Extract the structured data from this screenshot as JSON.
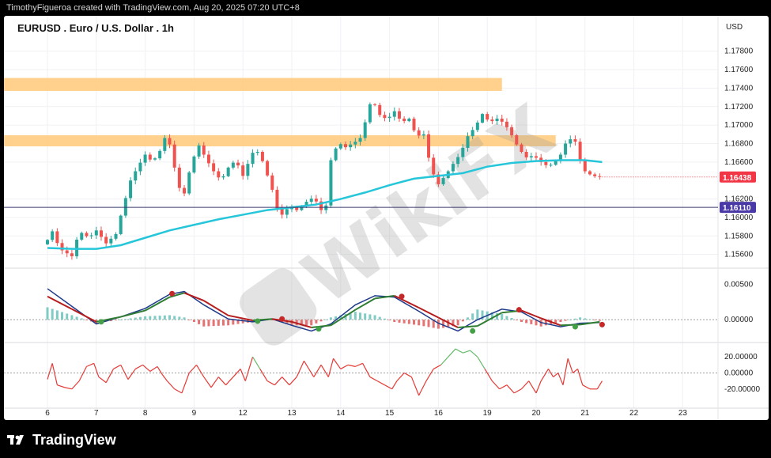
{
  "header": {
    "attribution": "TimothyFigueroa created with TradingView.com, Aug 20, 2025 07:20 UTC+8"
  },
  "footer": {
    "brand": "TradingView"
  },
  "watermark": {
    "text": "WikiFX"
  },
  "colors": {
    "up": "#26a69a",
    "down": "#ef5350",
    "zone": "#ffcc80",
    "ma": "#26c6da",
    "macd_fast": "#1e3a8a",
    "macd_slow": "#2e7d32",
    "price_badge": "#f23645",
    "level_badge": "#4a3aa8",
    "osc": "#e53935",
    "osc_high": "#66bb6a"
  },
  "chart_data": {
    "type": "candlestick",
    "title": "EURUSD . Euro / U.S. Dollar . 1h",
    "currency": "USD",
    "y_ticks": [
      "1.17800",
      "1.17600",
      "1.17400",
      "1.17200",
      "1.17000",
      "1.16800",
      "1.16600",
      "1.16200",
      "1.16000",
      "1.15800",
      "1.15600"
    ],
    "ylim": [
      1.1546,
      1.1796
    ],
    "x_ticks": [
      "6",
      "7",
      "8",
      "9",
      "12",
      "13",
      "14",
      "15",
      "16",
      "19",
      "20",
      "21",
      "22",
      "23"
    ],
    "last_price": {
      "label": "1.16438",
      "value": 1.16438
    },
    "horizontal_level": {
      "label": "1.16110",
      "value": 1.1611
    },
    "resistance_zones": [
      {
        "low": 1.1737,
        "high": 1.1751,
        "x_start": 0,
        "x_end": 9.3
      },
      {
        "low": 1.1677,
        "high": 1.1689,
        "x_start": 0,
        "x_end": 10.4
      }
    ],
    "price_path": [
      [
        0.0,
        1.1571
      ],
      [
        0.15,
        1.1585
      ],
      [
        0.3,
        1.1566
      ],
      [
        0.55,
        1.1558
      ],
      [
        0.7,
        1.1585
      ],
      [
        0.9,
        1.1578
      ],
      [
        1.05,
        1.1586
      ],
      [
        1.25,
        1.1572
      ],
      [
        1.45,
        1.1582
      ],
      [
        1.55,
        1.1602
      ],
      [
        1.75,
        1.164
      ],
      [
        1.9,
        1.1655
      ],
      [
        2.05,
        1.1668
      ],
      [
        2.2,
        1.166
      ],
      [
        2.35,
        1.1672
      ],
      [
        2.5,
        1.1693
      ],
      [
        2.6,
        1.1665
      ],
      [
        2.75,
        1.1632
      ],
      [
        2.85,
        1.1626
      ],
      [
        3.0,
        1.166
      ],
      [
        3.15,
        1.1678
      ],
      [
        3.3,
        1.1663
      ],
      [
        3.45,
        1.165
      ],
      [
        3.6,
        1.164
      ],
      [
        3.75,
        1.1654
      ],
      [
        3.9,
        1.1662
      ],
      [
        4.05,
        1.1645
      ],
      [
        4.15,
        1.1658
      ],
      [
        4.3,
        1.1676
      ],
      [
        4.45,
        1.1661
      ],
      [
        4.65,
        1.163
      ],
      [
        4.8,
        1.16
      ],
      [
        5.0,
        1.1612
      ],
      [
        5.15,
        1.1608
      ],
      [
        5.35,
        1.1617
      ],
      [
        5.5,
        1.1622
      ],
      [
        5.65,
        1.1608
      ],
      [
        5.75,
        1.1613
      ],
      [
        5.85,
        1.1662
      ],
      [
        6.0,
        1.1681
      ],
      [
        6.15,
        1.1676
      ],
      [
        6.35,
        1.1682
      ],
      [
        6.5,
        1.1688
      ],
      [
        6.6,
        1.1718
      ],
      [
        6.7,
        1.1727
      ],
      [
        6.85,
        1.1711
      ],
      [
        7.0,
        1.1706
      ],
      [
        7.15,
        1.1715
      ],
      [
        7.3,
        1.1703
      ],
      [
        7.45,
        1.1707
      ],
      [
        7.6,
        1.1688
      ],
      [
        7.75,
        1.169
      ],
      [
        7.9,
        1.1652
      ],
      [
        8.05,
        1.1636
      ],
      [
        8.2,
        1.1646
      ],
      [
        8.35,
        1.1658
      ],
      [
        8.5,
        1.1669
      ],
      [
        8.65,
        1.1688
      ],
      [
        8.8,
        1.1698
      ],
      [
        8.95,
        1.1712
      ],
      [
        9.1,
        1.1703
      ],
      [
        9.25,
        1.1707
      ],
      [
        9.4,
        1.1702
      ],
      [
        9.55,
        1.1689
      ],
      [
        9.7,
        1.1674
      ],
      [
        9.85,
        1.1665
      ],
      [
        10.0,
        1.1667
      ],
      [
        10.15,
        1.166
      ],
      [
        10.3,
        1.1655
      ],
      [
        10.45,
        1.1661
      ],
      [
        10.55,
        1.1668
      ],
      [
        10.7,
        1.1686
      ],
      [
        10.85,
        1.1682
      ],
      [
        10.95,
        1.1662
      ],
      [
        11.05,
        1.165
      ],
      [
        11.2,
        1.1645
      ],
      [
        11.35,
        1.1644
      ]
    ],
    "ma_path": [
      [
        0.0,
        1.1567
      ],
      [
        0.5,
        1.1566
      ],
      [
        1.0,
        1.1566
      ],
      [
        1.5,
        1.157
      ],
      [
        2.0,
        1.1578
      ],
      [
        2.5,
        1.1586
      ],
      [
        3.0,
        1.1592
      ],
      [
        3.5,
        1.1598
      ],
      [
        4.0,
        1.1603
      ],
      [
        4.5,
        1.1608
      ],
      [
        5.0,
        1.1611
      ],
      [
        5.5,
        1.1614
      ],
      [
        6.0,
        1.162
      ],
      [
        6.5,
        1.1627
      ],
      [
        7.0,
        1.1635
      ],
      [
        7.5,
        1.1642
      ],
      [
        8.0,
        1.1645
      ],
      [
        8.5,
        1.1648
      ],
      [
        9.0,
        1.1655
      ],
      [
        9.5,
        1.1659
      ],
      [
        10.0,
        1.1661
      ],
      [
        10.5,
        1.1662
      ],
      [
        11.0,
        1.1662
      ],
      [
        11.35,
        1.166
      ]
    ],
    "macd": {
      "y_ticks": [
        "0.00500",
        "0.00000"
      ],
      "ylim": [
        -0.0029,
        0.0072
      ],
      "fast": [
        [
          0.0,
          0.0044
        ],
        [
          0.5,
          0.0019
        ],
        [
          1.0,
          -0.0006
        ],
        [
          1.5,
          0.0004
        ],
        [
          2.0,
          0.0016
        ],
        [
          2.5,
          0.0036
        ],
        [
          2.8,
          0.004
        ],
        [
          3.2,
          0.0021
        ],
        [
          3.7,
          0.0001
        ],
        [
          4.2,
          -0.0003
        ],
        [
          4.6,
          0.0001
        ],
        [
          5.0,
          -0.0008
        ],
        [
          5.4,
          -0.0016
        ],
        [
          5.8,
          -0.0006
        ],
        [
          6.3,
          0.0021
        ],
        [
          6.7,
          0.0034
        ],
        [
          7.1,
          0.0032
        ],
        [
          7.6,
          0.0012
        ],
        [
          8.0,
          -0.0005
        ],
        [
          8.4,
          -0.0016
        ],
        [
          8.8,
          0.0
        ],
        [
          9.3,
          0.0015
        ],
        [
          9.7,
          0.0011
        ],
        [
          10.1,
          -0.0004
        ],
        [
          10.5,
          -0.001
        ],
        [
          10.9,
          -0.0005
        ],
        [
          11.3,
          -0.0004
        ]
      ],
      "slow": [
        [
          0.0,
          0.0033
        ],
        [
          0.5,
          0.0015
        ],
        [
          1.0,
          -0.0003
        ],
        [
          1.5,
          0.0004
        ],
        [
          2.0,
          0.0013
        ],
        [
          2.5,
          0.0032
        ],
        [
          2.8,
          0.0038
        ],
        [
          3.2,
          0.0027
        ],
        [
          3.7,
          0.0006
        ],
        [
          4.2,
          -0.0001
        ],
        [
          4.6,
          0.0001
        ],
        [
          5.0,
          -0.0003
        ],
        [
          5.4,
          -0.0011
        ],
        [
          5.8,
          -0.0008
        ],
        [
          6.3,
          0.0014
        ],
        [
          6.7,
          0.003
        ],
        [
          7.1,
          0.0034
        ],
        [
          7.6,
          0.0017
        ],
        [
          8.0,
          0.0003
        ],
        [
          8.4,
          -0.0011
        ],
        [
          8.8,
          -0.0009
        ],
        [
          9.3,
          0.001
        ],
        [
          9.7,
          0.0013
        ],
        [
          10.1,
          0.0002
        ],
        [
          10.5,
          -0.0008
        ],
        [
          10.9,
          -0.0007
        ],
        [
          11.3,
          -0.0003
        ]
      ],
      "dots": [
        {
          "x": 1.1,
          "y": -0.0003,
          "color": "green"
        },
        {
          "x": 2.55,
          "y": 0.0037,
          "color": "red"
        },
        {
          "x": 4.3,
          "y": -0.0002,
          "color": "green"
        },
        {
          "x": 4.8,
          "y": 0.0001,
          "color": "red"
        },
        {
          "x": 5.55,
          "y": -0.0013,
          "color": "green"
        },
        {
          "x": 7.25,
          "y": 0.0033,
          "color": "red"
        },
        {
          "x": 8.7,
          "y": -0.0016,
          "color": "green"
        },
        {
          "x": 9.65,
          "y": 0.0014,
          "color": "red"
        },
        {
          "x": 10.8,
          "y": -0.001,
          "color": "green"
        },
        {
          "x": 11.35,
          "y": -0.0007,
          "color": "red"
        }
      ]
    },
    "oscillator": {
      "y_ticks": [
        "20.00000",
        "0.00000",
        "-20.00000"
      ],
      "ylim": [
        -36,
        35
      ],
      "threshold": 0,
      "series": [
        [
          0.0,
          -8
        ],
        [
          0.1,
          12
        ],
        [
          0.2,
          -15
        ],
        [
          0.35,
          -18
        ],
        [
          0.5,
          -20
        ],
        [
          0.65,
          -10
        ],
        [
          0.8,
          8
        ],
        [
          0.95,
          12
        ],
        [
          1.05,
          -5
        ],
        [
          1.2,
          -12
        ],
        [
          1.35,
          5
        ],
        [
          1.5,
          10
        ],
        [
          1.65,
          -8
        ],
        [
          1.8,
          5
        ],
        [
          1.95,
          10
        ],
        [
          2.1,
          2
        ],
        [
          2.25,
          8
        ],
        [
          2.35,
          -2
        ],
        [
          2.45,
          -10
        ],
        [
          2.6,
          -20
        ],
        [
          2.75,
          -25
        ],
        [
          2.9,
          0
        ],
        [
          3.05,
          10
        ],
        [
          3.2,
          -5
        ],
        [
          3.35,
          -18
        ],
        [
          3.5,
          -5
        ],
        [
          3.65,
          -15
        ],
        [
          3.8,
          -5
        ],
        [
          3.95,
          5
        ],
        [
          4.05,
          -10
        ],
        [
          4.2,
          20
        ],
        [
          4.35,
          5
        ],
        [
          4.5,
          -10
        ],
        [
          4.65,
          -15
        ],
        [
          4.8,
          -5
        ],
        [
          4.95,
          -15
        ],
        [
          5.1,
          -5
        ],
        [
          5.25,
          15
        ],
        [
          5.35,
          5
        ],
        [
          5.45,
          -5
        ],
        [
          5.6,
          10
        ],
        [
          5.75,
          -5
        ],
        [
          5.85,
          18
        ],
        [
          6.0,
          5
        ],
        [
          6.15,
          10
        ],
        [
          6.3,
          8
        ],
        [
          6.45,
          12
        ],
        [
          6.6,
          -5
        ],
        [
          6.75,
          -10
        ],
        [
          6.9,
          -15
        ],
        [
          7.05,
          -20
        ],
        [
          7.15,
          -10
        ],
        [
          7.3,
          0
        ],
        [
          7.45,
          -5
        ],
        [
          7.6,
          -28
        ],
        [
          7.75,
          -10
        ],
        [
          7.9,
          5
        ],
        [
          8.05,
          10
        ],
        [
          8.2,
          20
        ],
        [
          8.35,
          30
        ],
        [
          8.5,
          25
        ],
        [
          8.65,
          28
        ],
        [
          8.8,
          20
        ],
        [
          8.95,
          5
        ],
        [
          9.1,
          -10
        ],
        [
          9.25,
          -20
        ],
        [
          9.4,
          -15
        ],
        [
          9.55,
          -25
        ],
        [
          9.7,
          -20
        ],
        [
          9.85,
          -10
        ],
        [
          10.0,
          -25
        ],
        [
          10.1,
          -10
        ],
        [
          10.25,
          5
        ],
        [
          10.35,
          -5
        ],
        [
          10.45,
          0
        ],
        [
          10.55,
          -15
        ],
        [
          10.65,
          18
        ],
        [
          10.75,
          0
        ],
        [
          10.85,
          5
        ],
        [
          10.95,
          -15
        ],
        [
          11.1,
          -20
        ],
        [
          11.25,
          -20
        ],
        [
          11.35,
          -10
        ]
      ]
    }
  }
}
